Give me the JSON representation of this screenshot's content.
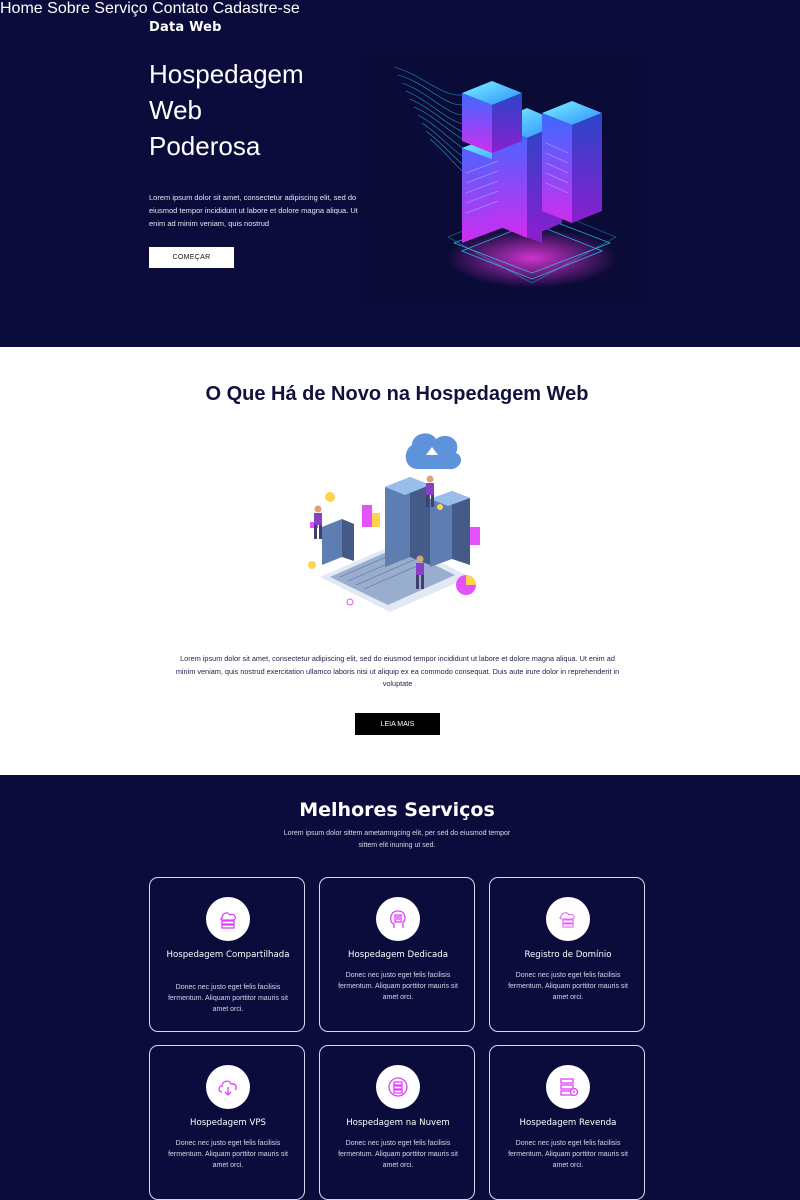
{
  "header": {
    "brand": "Data Web",
    "nav": [
      {
        "label": "Home",
        "active": true
      },
      {
        "label": "Sobre",
        "active": false
      },
      {
        "label": "Serviço",
        "active": false
      },
      {
        "label": "Contato",
        "active": false
      },
      {
        "label": "Cadastre-se",
        "active": false
      }
    ]
  },
  "hero": {
    "title_lines": [
      "Hospedagem",
      "Web",
      "Poderosa"
    ],
    "text": "Lorem ipsum dolor sit amet, consectetur adipiscing elit, sed do eiusmod tempor incididunt ut labore et dolore magna aliqua. Ut enim ad minim veniam, quis nostrud",
    "button": "COMEÇAR"
  },
  "news": {
    "title": "O Que Há de Novo na Hospedagem Web",
    "text": "Lorem ipsum dolor sit amet, consectetur adipiscing elit, sed do eiusmod tempor incididunt ut labore et dolore magna aliqua. Ut enim ad minim veniam, quis nostrud exercitation ullamco laboris nisi ut aliquip ex ea commodo consequat. Duis aute irure dolor in reprehenderit in voluptate",
    "button": "LEIA MAIS"
  },
  "services": {
    "title": "Melhores Serviços",
    "subtitle": "Lorem ipsum dolor sittem ametamngcing elit, per sed do eiusmod tempor sittem elit inuning ut sed.",
    "cards": [
      {
        "title": "Hospedagem Compartilhada",
        "desc": "Donec nec justo eget felis facilisis fermentum. Aliquam porttitor mauris sit amet orci.",
        "icon": "shared-hosting-icon"
      },
      {
        "title": "Hospedagem Dedicada",
        "desc": "Donec nec justo eget felis facilisis fermentum. Aliquam porttitor mauris sit amet orci.",
        "icon": "dedicated-hosting-icon"
      },
      {
        "title": "Registro de Domínio",
        "desc": "Donec nec justo eget felis facilisis fermentum. Aliquam porttitor mauris sit amet orci.",
        "icon": "domain-registration-icon"
      },
      {
        "title": "Hospedagem VPS",
        "desc": "Donec nec justo eget felis facilisis fermentum. Aliquam porttitor mauris sit amet orci.",
        "icon": "cloud-vps-icon"
      },
      {
        "title": "Hospedagem na Nuvem",
        "desc": "Donec nec justo eget felis facilisis fermentum. Aliquam porttitor mauris sit amet orci.",
        "icon": "cloud-hosting-icon"
      },
      {
        "title": "Hospedagem Revenda",
        "desc": "Donec nec justo eget felis facilisis fermentum. Aliquam porttitor mauris sit amet orci.",
        "icon": "reseller-hosting-icon"
      }
    ]
  },
  "colors": {
    "navy": "#0b0c3c",
    "active_nav": "#f5c518",
    "accent_magenta": "#e040fb",
    "accent_cyan": "#2fd3ff"
  }
}
